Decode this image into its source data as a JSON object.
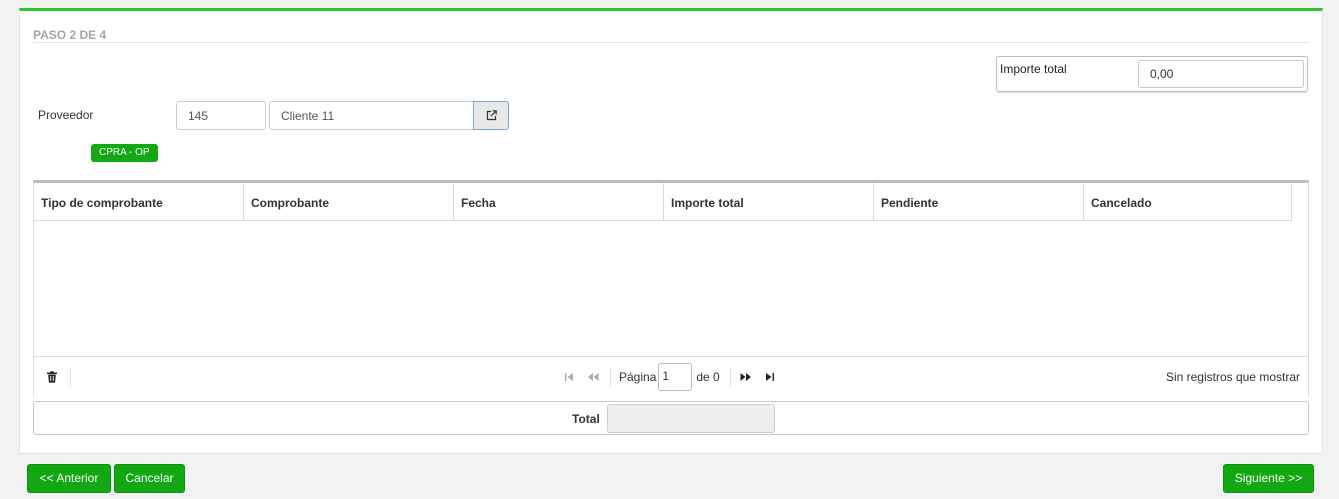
{
  "wizard": {
    "step_title": "PASO 2 DE 4"
  },
  "importe_total": {
    "label": "Importe total",
    "value": "0,00"
  },
  "proveedor": {
    "label": "Proveedor",
    "code": "145",
    "name": "Cliente 11",
    "open_icon": "external-link-icon"
  },
  "badge": {
    "label": "CPRA - OP"
  },
  "grid": {
    "columns": [
      "Tipo de comprobante",
      "Comprobante",
      "Fecha",
      "Importe total",
      "Pendiente",
      "Cancelado"
    ],
    "rows": []
  },
  "pager": {
    "page_label": "Página",
    "page_value": "1",
    "of_label": "de 0",
    "empty_message": "Sin registros que mostrar",
    "icons": [
      "trash-icon",
      "first-page-icon",
      "prev-page-icon",
      "next-page-icon",
      "last-page-icon"
    ]
  },
  "total_row": {
    "label": "Total",
    "value": ""
  },
  "buttons": {
    "previous": "<< Anterior",
    "cancel": "Cancelar",
    "next": "Siguiente >>"
  },
  "colors": {
    "accent": "#2ec52e",
    "button": "#11a811"
  }
}
